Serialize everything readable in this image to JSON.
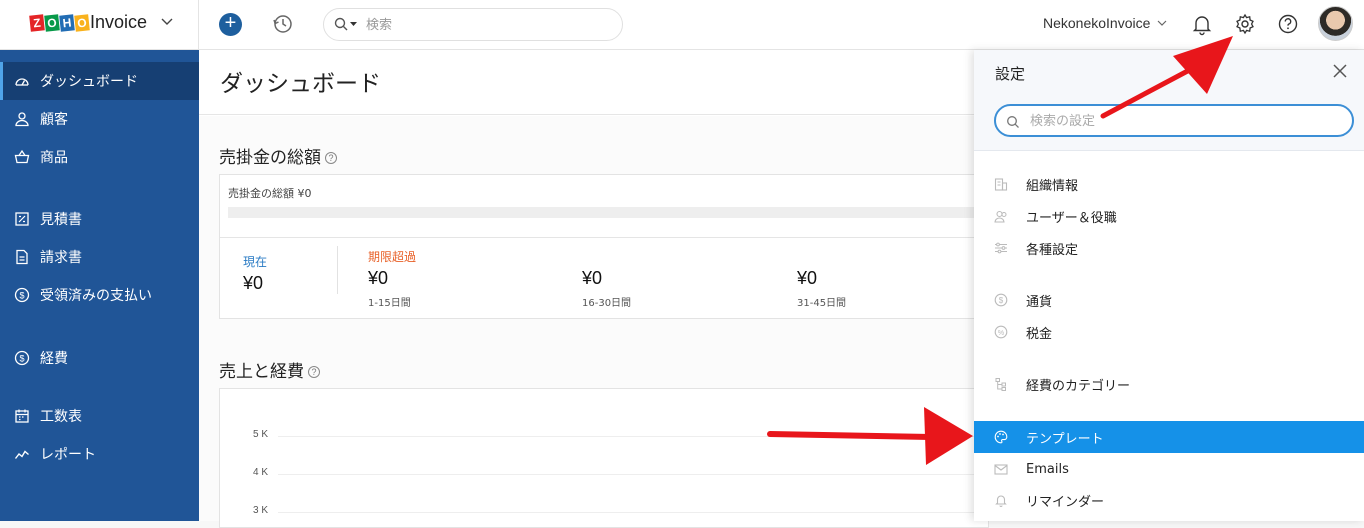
{
  "header": {
    "brand_letters": [
      "Z",
      "O",
      "H",
      "O"
    ],
    "brand_colors": [
      "#e42527",
      "#089949",
      "#226db4",
      "#f9b21d"
    ],
    "app_name": "Invoice",
    "search_placeholder": "検索",
    "org_name": "NekonekoInvoice"
  },
  "sidebar": {
    "items": [
      {
        "label": "ダッシュボード",
        "icon": "dashboard-icon"
      },
      {
        "label": "顧客",
        "icon": "user-icon"
      },
      {
        "label": "商品",
        "icon": "basket-icon"
      },
      {
        "label": "見積書",
        "icon": "estimate-icon"
      },
      {
        "label": "請求書",
        "icon": "invoice-icon"
      },
      {
        "label": "受領済みの支払い",
        "icon": "payment-icon"
      },
      {
        "label": "経費",
        "icon": "expense-icon"
      },
      {
        "label": "工数表",
        "icon": "timesheet-icon"
      },
      {
        "label": "レポート",
        "icon": "report-icon"
      }
    ]
  },
  "main": {
    "title": "ダッシュボード",
    "receivables": {
      "title": "売掛金の総額",
      "summary": "売掛金の総額 ¥0",
      "stats": [
        {
          "label": "現在",
          "amount": "¥0",
          "sub": ""
        },
        {
          "label": "期限超過",
          "amount": "¥0",
          "sub": "1-15日間"
        },
        {
          "label": "",
          "amount": "¥0",
          "sub": "16-30日間"
        },
        {
          "label": "",
          "amount": "¥0",
          "sub": "31-45日間"
        }
      ]
    },
    "sales_expenses": {
      "title": "売上と経費",
      "y_ticks": [
        "5 K",
        "4 K",
        "3 K"
      ]
    }
  },
  "settings_panel": {
    "title": "設定",
    "search_placeholder": "検索の設定",
    "items": [
      {
        "label": "組織情報",
        "icon": "building-icon"
      },
      {
        "label": "ユーザー＆役職",
        "icon": "users-icon"
      },
      {
        "label": "各種設定",
        "icon": "sliders-icon"
      },
      {
        "label": "通貨",
        "icon": "currency-icon"
      },
      {
        "label": "税金",
        "icon": "percent-icon"
      },
      {
        "label": "経費のカテゴリー",
        "icon": "category-icon"
      },
      {
        "label": "テンプレート",
        "icon": "palette-icon"
      },
      {
        "label": "Emails",
        "icon": "mail-icon"
      },
      {
        "label": "リマインダー",
        "icon": "bell-icon"
      }
    ]
  },
  "colors": {
    "sidebar_bg": "#205597",
    "accent_blue": "#1591e8",
    "overdue_orange": "#e8622a",
    "current_blue": "#2a7bc4",
    "annotation_red": "#e8161b"
  }
}
